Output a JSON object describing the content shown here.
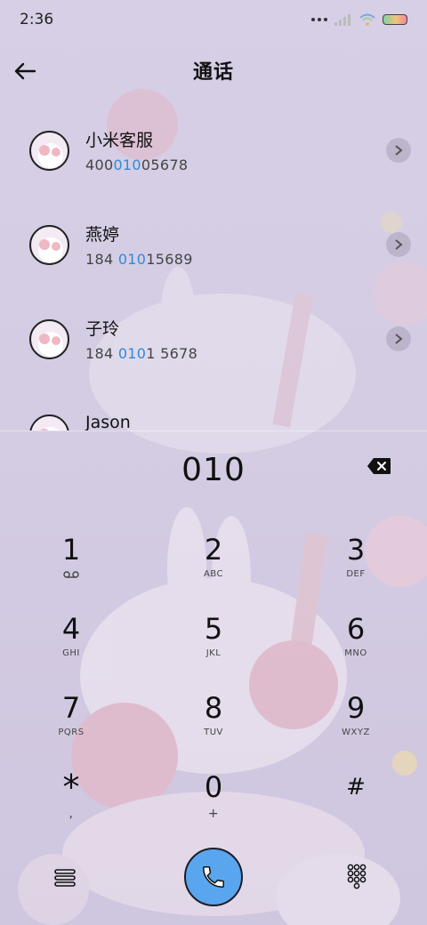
{
  "status_bar": {
    "time": "2:36"
  },
  "header": {
    "title": "通话"
  },
  "contacts": [
    {
      "name": "小米客服",
      "num_pre": "400",
      "num_hl": "010",
      "num_post": "05678"
    },
    {
      "name": "燕婷",
      "num_pre": "184 ",
      "num_hl": "010",
      "num_post": "15689"
    },
    {
      "name": "子玲",
      "num_pre": "184 ",
      "num_hl": "010",
      "num_post": "1 5678"
    },
    {
      "name": "Jason",
      "num_pre": "",
      "num_hl": "",
      "num_post": ""
    }
  ],
  "dialer": {
    "number": "010"
  },
  "keys": [
    {
      "digit": "1",
      "letters": ""
    },
    {
      "digit": "2",
      "letters": "ABC"
    },
    {
      "digit": "3",
      "letters": "DEF"
    },
    {
      "digit": "4",
      "letters": "GHI"
    },
    {
      "digit": "5",
      "letters": "JKL"
    },
    {
      "digit": "6",
      "letters": "MNO"
    },
    {
      "digit": "7",
      "letters": "PQRS"
    },
    {
      "digit": "8",
      "letters": "TUV"
    },
    {
      "digit": "9",
      "letters": "WXYZ"
    },
    {
      "digit": "*",
      "letters": ","
    },
    {
      "digit": "0",
      "letters": "+"
    },
    {
      "digit": "#",
      "letters": ""
    }
  ],
  "icons": {
    "back": "arrow-left-icon",
    "backspace": "backspace-icon",
    "call": "phone-icon",
    "menu": "menu-icon",
    "keypad": "keypad-icon",
    "voicemail": "voicemail-icon",
    "chevron": "chevron-right-icon"
  },
  "colors": {
    "highlight": "#2f8ad8",
    "call_button": "#5aa6ee",
    "background": "#d7cfe5"
  }
}
